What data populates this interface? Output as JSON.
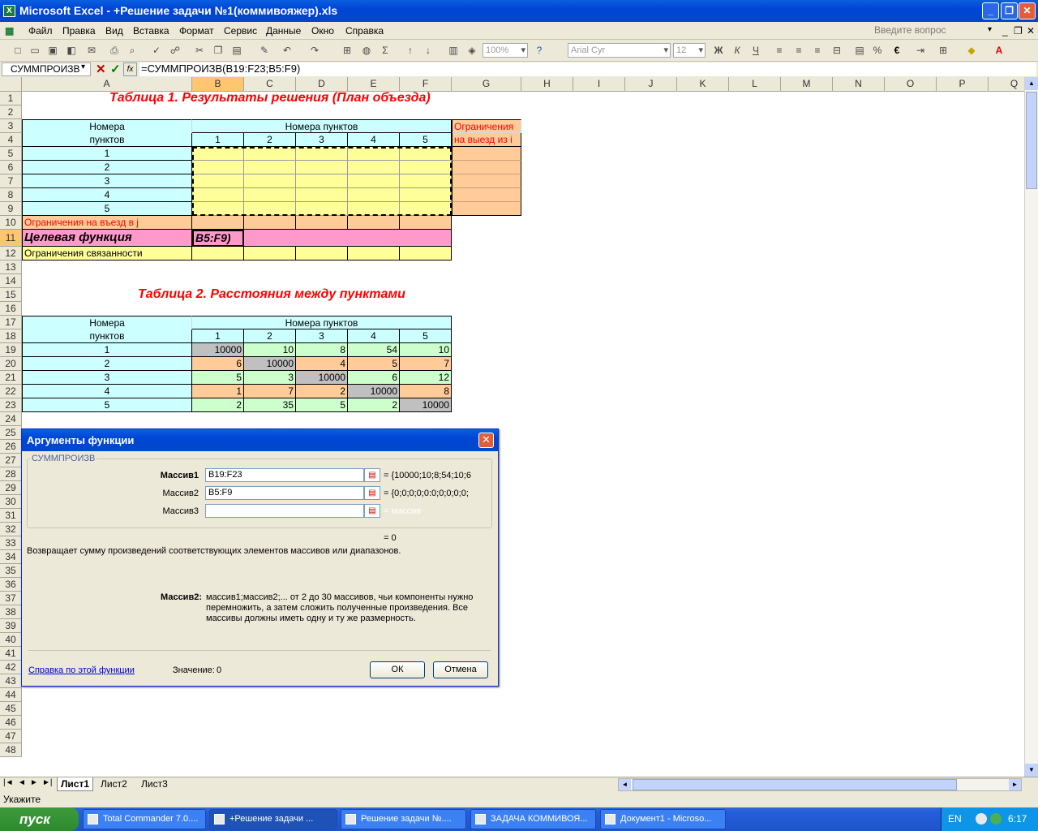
{
  "window": {
    "title": "Microsoft Excel - +Решение задачи №1(коммивояжер).xls"
  },
  "menu": [
    "Файл",
    "Правка",
    "Вид",
    "Вставка",
    "Формат",
    "Сервис",
    "Данные",
    "Окно",
    "Справка"
  ],
  "help_box": "Введите вопрос",
  "toolbar": {
    "zoom": "100%",
    "font": "Arial Cyr",
    "size": "12"
  },
  "formula_bar": {
    "name_box": "СУММПРОИЗВ",
    "formula": "=СУММПРОИЗВ(B19:F23;B5:F9)"
  },
  "columns": [
    "A",
    "B",
    "C",
    "D",
    "E",
    "F",
    "G",
    "H",
    "I",
    "J",
    "K",
    "L",
    "M",
    "N",
    "O",
    "P",
    "Q"
  ],
  "sheet": {
    "table1_title": "Таблица 1. Результаты решения (План объезда)",
    "nomera": "Номера",
    "punktov": "пунктов",
    "nomera_punktov": "Номера пунктов",
    "ogr_header1": "Ограничения",
    "ogr_header2": "на выезд из i",
    "ogr_vezd": "Ограничения на въезд в j",
    "target": "Целевая функция",
    "target_edit": "B5:F9)",
    "ogr_svyaz": "Ограничения связанности",
    "table2_title": "Таблица 2. Расстояния между пунктами",
    "idx": [
      "1",
      "2",
      "3",
      "4",
      "5"
    ],
    "distances": [
      [
        "10000",
        "10",
        "8",
        "54",
        "10"
      ],
      [
        "6",
        "10000",
        "4",
        "5",
        "7"
      ],
      [
        "5",
        "3",
        "10000",
        "6",
        "12"
      ],
      [
        "1",
        "7",
        "2",
        "10000",
        "8"
      ],
      [
        "2",
        "35",
        "5",
        "2",
        "10000"
      ]
    ]
  },
  "tabs": [
    "Лист1",
    "Лист2",
    "Лист3"
  ],
  "status": "Укажите",
  "dialog": {
    "title": "Аргументы функции",
    "func": "СУММПРОИЗВ",
    "args": [
      {
        "label": "Массив1",
        "value": "B19:F23",
        "result": "= {10000;10;8;54;10;6"
      },
      {
        "label": "Массив2",
        "value": "B5:F9",
        "result": "= {0;0;0;0;0:0;0;0;0;0;"
      },
      {
        "label": "Массив3",
        "value": "",
        "result": "= массив"
      }
    ],
    "total": "= 0",
    "description": "Возвращает сумму произведений соответствующих элементов массивов или диапазонов.",
    "arg_help_label": "Массив2:",
    "arg_help_text": [
      "массив1;массив2;... от 2 до 30 массивов, чьи компоненты нужно",
      "перемножить, а затем сложить полученные произведения. Все",
      "массивы должны иметь одну и ту же размерность."
    ],
    "help_link": "Справка по этой функции",
    "value_label": "Значение:",
    "value": "0",
    "ok": "ОК",
    "cancel": "Отмена"
  },
  "taskbar": {
    "start": "пуск",
    "tasks": [
      "Total Commander 7.0....",
      "+Решение задачи ...",
      "Решение задачи №....",
      "ЗАДАЧА КОММИВОЯ...",
      "Документ1 - Microso..."
    ],
    "lang": "EN",
    "time": "6:17"
  }
}
